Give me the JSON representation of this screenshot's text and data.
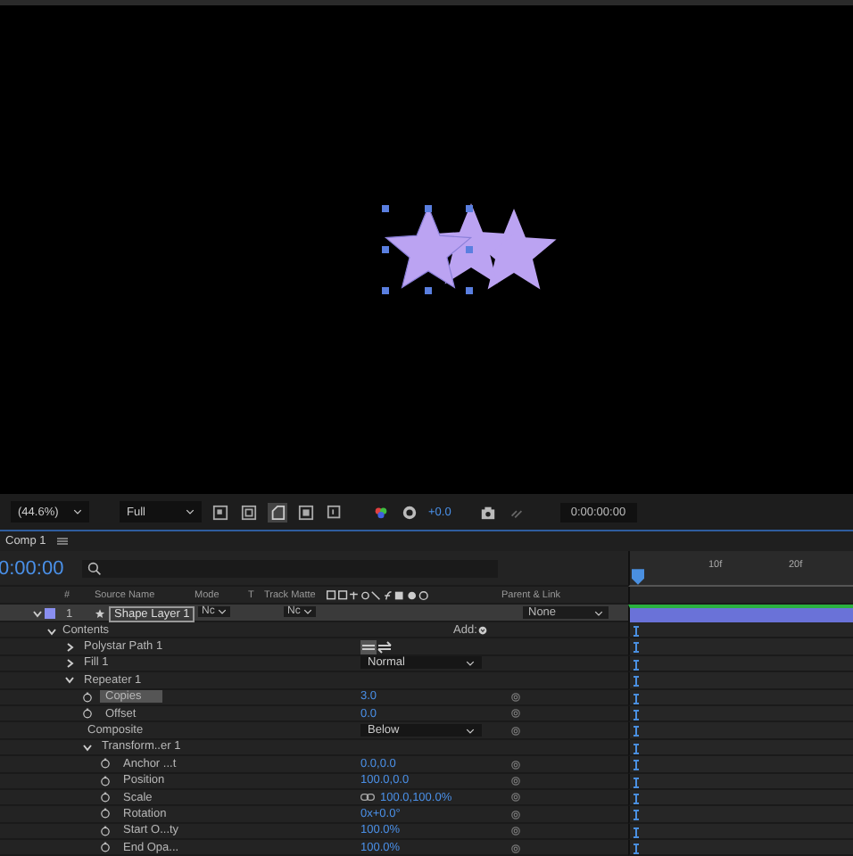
{
  "toolbar": {
    "zoom": "(44.6%)",
    "resolution": "Full",
    "exposure": "+0.0",
    "timecode": "0:00:00:00"
  },
  "comp_tab": {
    "label": "Comp 1"
  },
  "timeline": {
    "current_time": "0:00:00",
    "ruler": [
      "10f",
      "20f"
    ]
  },
  "columns": [
    "#",
    "Source Name",
    "Mode",
    "T",
    "Track Matte",
    "Parent & Link"
  ],
  "layer": {
    "number": "1",
    "name": "Shape Layer 1",
    "color": "#8a8ff0",
    "mode": "Nc",
    "track_matte": "Nc",
    "parent": "None",
    "expanded": true
  },
  "contents": {
    "label": "Contents",
    "expanded": true,
    "add_label": "Add:",
    "children": [
      {
        "kind": "group",
        "name": "Polystar Path 1",
        "expanded": false,
        "direction_toggle": true
      },
      {
        "kind": "group",
        "name": "Fill 1",
        "expanded": false,
        "dropdown": "Normal"
      },
      {
        "kind": "group",
        "name": "Repeater 1",
        "expanded": true,
        "children": [
          {
            "kind": "property",
            "name": "Copies",
            "value": "3.0",
            "selected": true
          },
          {
            "kind": "property",
            "name": "Offset",
            "value": "0.0",
            "selected": false
          },
          {
            "kind": "plain",
            "name": "Composite",
            "dropdown": "Below"
          },
          {
            "kind": "group",
            "name": "Transform..er 1",
            "expanded": true,
            "children": [
              {
                "kind": "property",
                "name": "Anchor ...t",
                "value": "0.0,0.0",
                "selected": false,
                "constrained": false
              },
              {
                "kind": "property",
                "name": "Position",
                "value": "100.0,0.0",
                "selected": false,
                "constrained": false
              },
              {
                "kind": "property",
                "name": "Scale",
                "value": "100.0,100.0%",
                "selected": false,
                "constrained": true
              },
              {
                "kind": "property",
                "name": "Rotation",
                "value": "0x+0.0°",
                "selected": false,
                "constrained": false
              },
              {
                "kind": "property",
                "name": "Start O...ty",
                "value": "100.0%",
                "selected": false,
                "constrained": false
              },
              {
                "kind": "property",
                "name": "End Opa...",
                "value": "100.0%",
                "selected": false,
                "constrained": false
              }
            ]
          }
        ]
      }
    ]
  }
}
